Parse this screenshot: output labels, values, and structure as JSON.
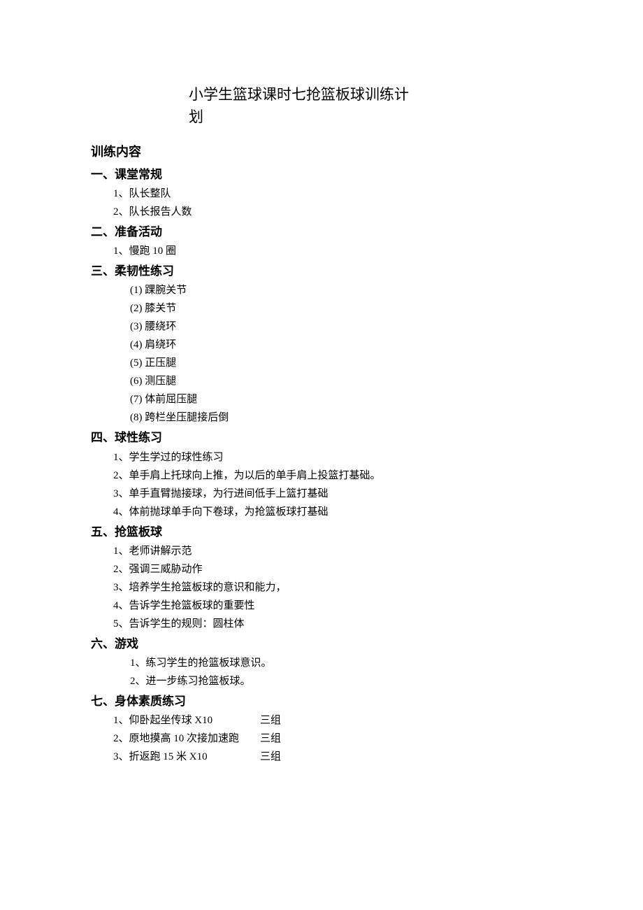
{
  "title": "小学生篮球课时七抢篮板球训练计划",
  "content_heading": "训练内容",
  "sections": {
    "s1": {
      "heading": "一、课堂常规",
      "items": [
        "1、队长整队",
        "2、队长报告人数"
      ]
    },
    "s2": {
      "heading": "二、准备活动",
      "items": [
        "1、慢跑 10 圈"
      ]
    },
    "s3": {
      "heading": "三、柔韧性练习",
      "items": [
        "(1) 踝腕关节",
        "(2) 膝关节",
        "(3) 腰绕环",
        "(4) 肩绕环",
        "(5) 正压腿",
        "(6) 测压腿",
        "(7) 体前屈压腿",
        "(8) 跨栏坐压腿接后倒"
      ]
    },
    "s4": {
      "heading": "四、球性练习",
      "items": [
        "1、学生学过的球性练习",
        "2、单手肩上托球向上推，为以后的单手肩上投篮打基础。",
        "3、单手直臂抛接球，为行进间低手上篮打基础",
        "4、体前抛球单手向下卷球，为抢篮板球打基础"
      ]
    },
    "s5": {
      "heading": "五、抢篮板球",
      "items": [
        "1、老师讲解示范",
        "2、强调三威胁动作",
        "3、培养学生抢篮板球的意识和能力，",
        "4、告诉学生抢篮板球的重要性",
        "5、告诉学生的规则：圆柱体"
      ]
    },
    "s6": {
      "heading": "六、游戏",
      "items": [
        "1、练习学生的抢篮板球意识。",
        "2、进一步练习抢篮板球。"
      ]
    },
    "s7": {
      "heading": "七、身体素质练习",
      "rows": [
        {
          "left": "1、仰卧起坐传球 X10",
          "right": "三组"
        },
        {
          "left": "2、原地摸高 10 次接加速跑",
          "right": "三组"
        },
        {
          "left": "3、折返跑 15 米 X10",
          "right": "三组"
        }
      ]
    }
  }
}
